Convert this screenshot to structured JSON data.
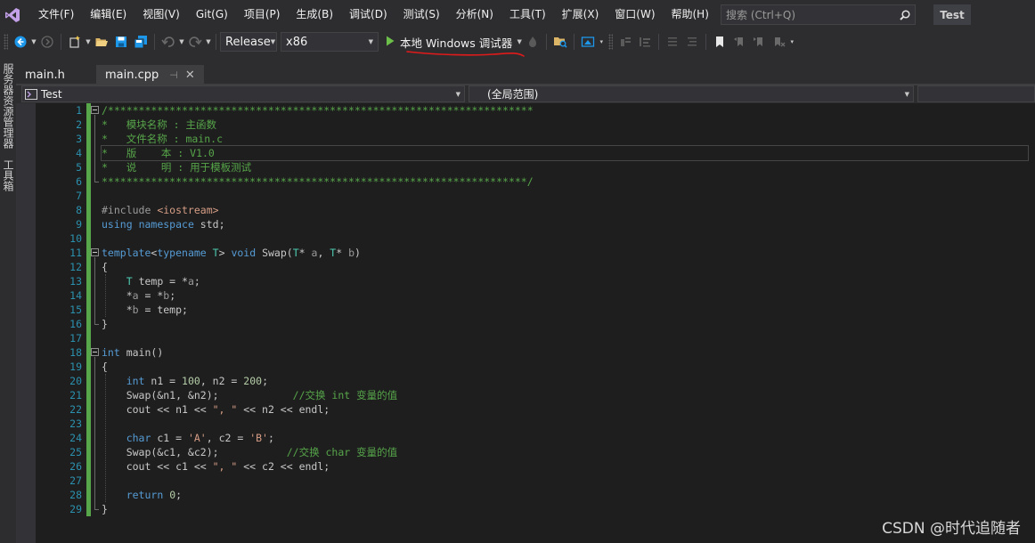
{
  "menubar": {
    "items": [
      "文件(F)",
      "编辑(E)",
      "视图(V)",
      "Git(G)",
      "项目(P)",
      "生成(B)",
      "调试(D)",
      "测试(S)",
      "分析(N)",
      "工具(T)",
      "扩展(X)",
      "窗口(W)",
      "帮助(H)"
    ],
    "search_placeholder": "搜索 (Ctrl+Q)",
    "project_name": "Test"
  },
  "toolbar": {
    "configuration": "Release",
    "platform": "x86",
    "run_label": "本地 Windows 调试器"
  },
  "left_strip": {
    "tabs": [
      "服务器资源管理器",
      "工具箱"
    ]
  },
  "doc_tabs": [
    {
      "label": "main.h",
      "active": false
    },
    {
      "label": "main.cpp",
      "active": true,
      "pin": "⊣",
      "close": "✕"
    }
  ],
  "navbar": {
    "project": "Test",
    "scope": "(全局范围)"
  },
  "editor": {
    "current_line": 4,
    "line_numbers": [
      "1",
      "2",
      "3",
      "4",
      "5",
      "6",
      "7",
      "8",
      "9",
      "10",
      "11",
      "12",
      "13",
      "14",
      "15",
      "16",
      "17",
      "18",
      "19",
      "20",
      "21",
      "22",
      "23",
      "24",
      "25",
      "26",
      "27",
      "28",
      "29"
    ],
    "lines": [
      [
        [
          "comment",
          "/*********************************************************************"
        ]
      ],
      [
        [
          "comment",
          "*   模块名称 : 主函数"
        ]
      ],
      [
        [
          "comment",
          "*   文件名称 : main.c"
        ]
      ],
      [
        [
          "comment",
          "*   版    本 : V1.0"
        ]
      ],
      [
        [
          "comment",
          "*   说    明 : 用于模板测试"
        ]
      ],
      [
        [
          "comment",
          "*********************************************************************/"
        ]
      ],
      [],
      [
        [
          "pre",
          "#include "
        ],
        [
          "str",
          "<iostream>"
        ]
      ],
      [
        [
          "kw",
          "using"
        ],
        [
          "plain",
          " "
        ],
        [
          "kw",
          "namespace"
        ],
        [
          "plain",
          " std;"
        ]
      ],
      [],
      [
        [
          "kw",
          "template"
        ],
        [
          "plain",
          "<"
        ],
        [
          "kw",
          "typename"
        ],
        [
          "plain",
          " "
        ],
        [
          "type",
          "T"
        ],
        [
          "plain",
          "> "
        ],
        [
          "kw",
          "void"
        ],
        [
          "plain",
          " Swap("
        ],
        [
          "type",
          "T"
        ],
        [
          "plain",
          "* "
        ],
        [
          "param",
          "a"
        ],
        [
          "plain",
          ", "
        ],
        [
          "type",
          "T"
        ],
        [
          "plain",
          "* "
        ],
        [
          "param",
          "b"
        ],
        [
          "plain",
          ")"
        ]
      ],
      [
        [
          "plain",
          "{"
        ]
      ],
      [
        [
          "plain",
          "    "
        ],
        [
          "type",
          "T"
        ],
        [
          "plain",
          " temp = *"
        ],
        [
          "param",
          "a"
        ],
        [
          "plain",
          ";"
        ]
      ],
      [
        [
          "plain",
          "    *"
        ],
        [
          "param",
          "a"
        ],
        [
          "plain",
          " = *"
        ],
        [
          "param",
          "b"
        ],
        [
          "plain",
          ";"
        ]
      ],
      [
        [
          "plain",
          "    *"
        ],
        [
          "param",
          "b"
        ],
        [
          "plain",
          " = temp;"
        ]
      ],
      [
        [
          "plain",
          "}"
        ]
      ],
      [],
      [
        [
          "kw",
          "int"
        ],
        [
          "plain",
          " main()"
        ]
      ],
      [
        [
          "plain",
          "{"
        ]
      ],
      [
        [
          "plain",
          "    "
        ],
        [
          "kw",
          "int"
        ],
        [
          "plain",
          " n1 = "
        ],
        [
          "num",
          "100"
        ],
        [
          "plain",
          ", n2 = "
        ],
        [
          "num",
          "200"
        ],
        [
          "plain",
          ";"
        ]
      ],
      [
        [
          "plain",
          "    Swap(&n1, &n2);            "
        ],
        [
          "comment",
          "//交换 int 变量的值"
        ]
      ],
      [
        [
          "plain",
          "    cout << n1 << "
        ],
        [
          "str",
          "\", \""
        ],
        [
          "plain",
          " << n2 << endl;"
        ]
      ],
      [],
      [
        [
          "plain",
          "    "
        ],
        [
          "kw",
          "char"
        ],
        [
          "plain",
          " c1 = "
        ],
        [
          "str",
          "'A'"
        ],
        [
          "plain",
          ", c2 = "
        ],
        [
          "str",
          "'B'"
        ],
        [
          "plain",
          ";"
        ]
      ],
      [
        [
          "plain",
          "    Swap(&c1, &c2);           "
        ],
        [
          "comment",
          "//交换 char 变量的值"
        ]
      ],
      [
        [
          "plain",
          "    cout << c1 << "
        ],
        [
          "str",
          "\", \""
        ],
        [
          "plain",
          " << c2 << endl;"
        ]
      ],
      [],
      [
        [
          "plain",
          "    "
        ],
        [
          "kw",
          "return"
        ],
        [
          "plain",
          " "
        ],
        [
          "num",
          "0"
        ],
        [
          "plain",
          ";"
        ]
      ],
      [
        [
          "plain",
          "}"
        ]
      ]
    ]
  },
  "watermark": "CSDN @时代追随者"
}
